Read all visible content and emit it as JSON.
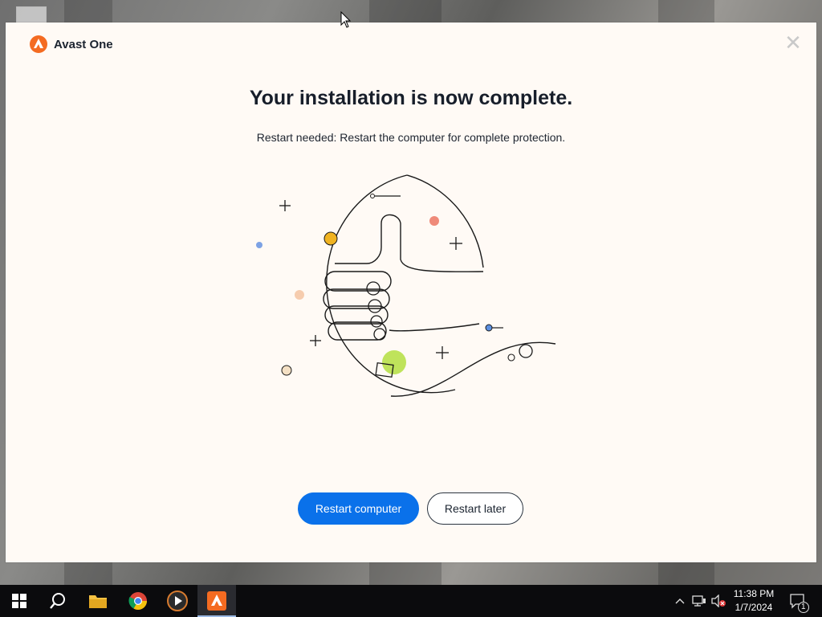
{
  "window": {
    "app_name": "Avast One",
    "close_symbol": "✕",
    "headline": "Your installation is now complete.",
    "subtext": "Restart needed: Restart the computer for complete protection.",
    "illustration_icon": "thumbs-up-icon",
    "buttons": {
      "restart_now": "Restart computer",
      "restart_later": "Restart later"
    }
  },
  "colors": {
    "accent": "#0a71ea",
    "brand_orange": "#f46b21",
    "background": "#fffaf5"
  },
  "taskbar": {
    "apps": [
      "start-icon",
      "search-icon",
      "file-explorer-icon",
      "chrome-icon",
      "media-player-icon",
      "avast-icon"
    ],
    "clock": {
      "time": "11:38 PM",
      "date": "1/7/2024"
    },
    "notification_count": "1"
  }
}
